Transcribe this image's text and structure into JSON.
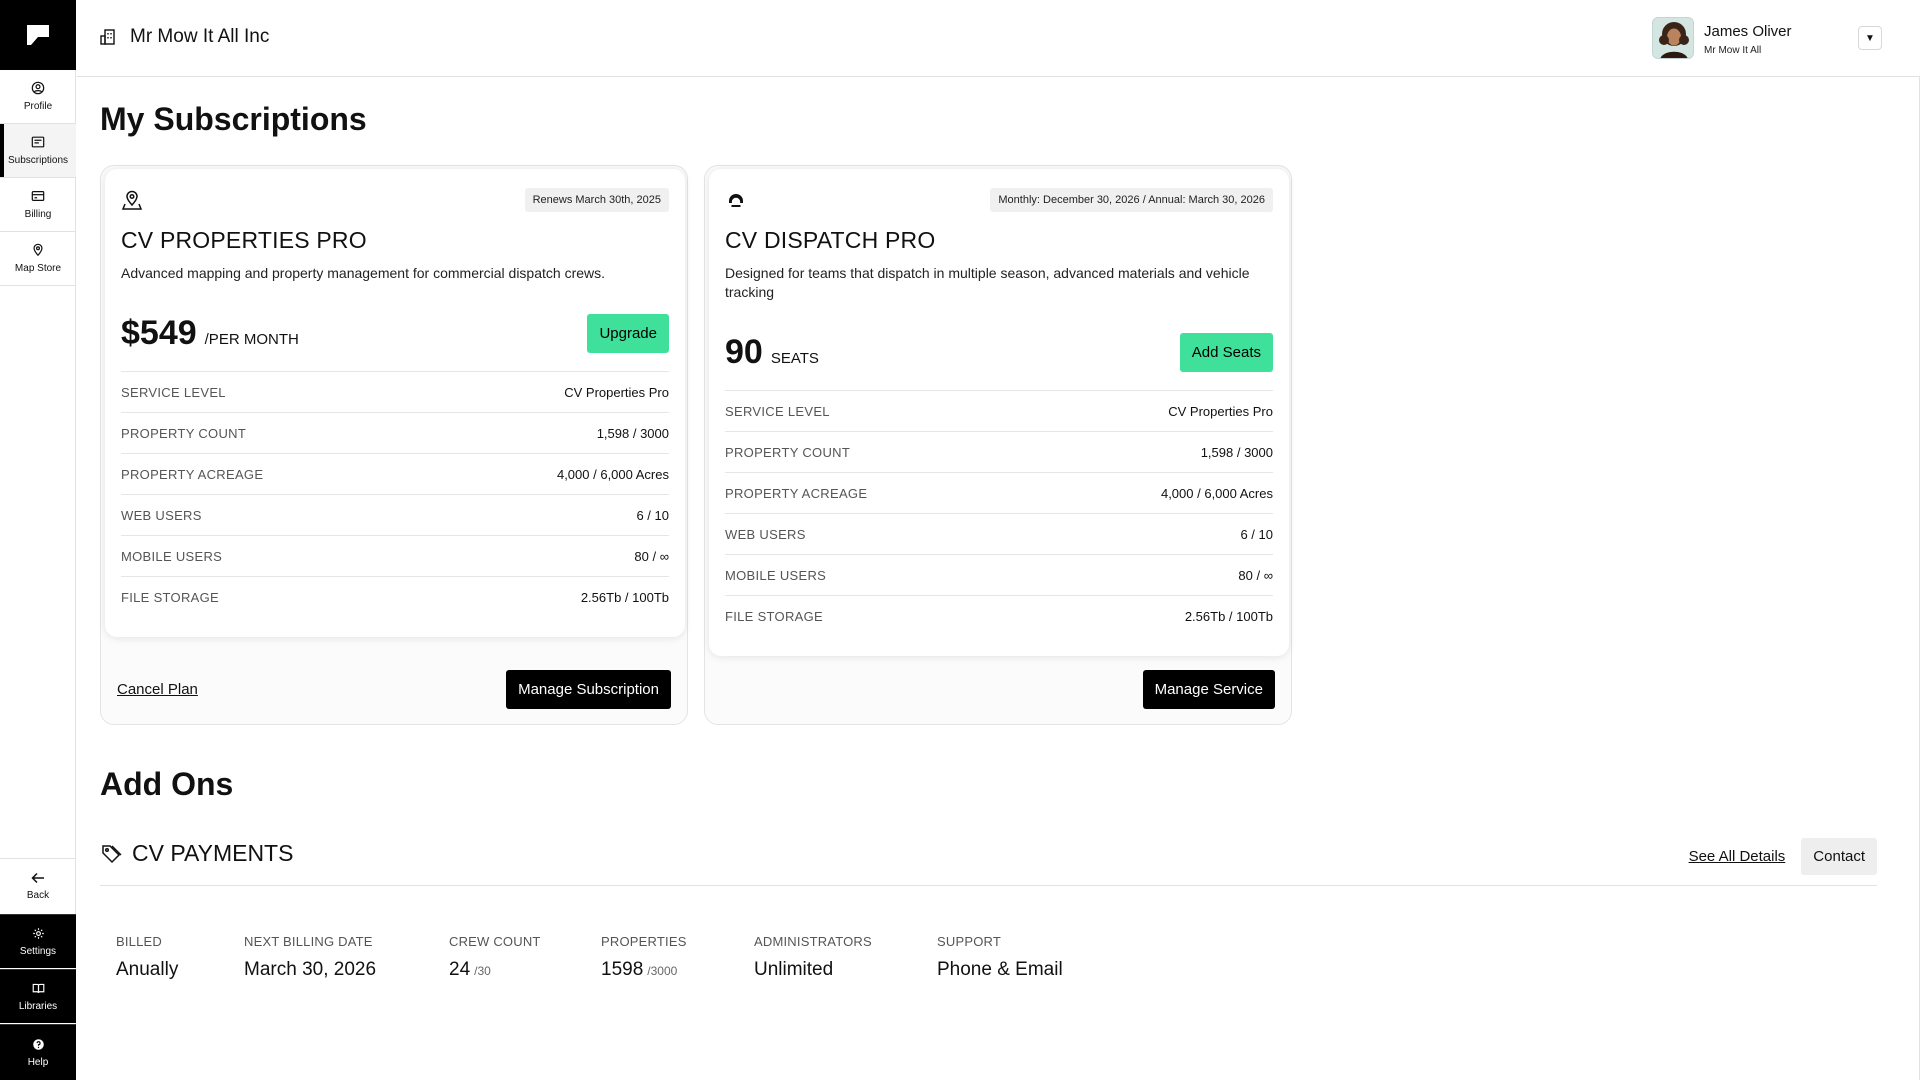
{
  "sidebar": {
    "items": [
      {
        "label": "Profile",
        "icon": "profile-icon"
      },
      {
        "label": "Subscriptions",
        "icon": "subscriptions-icon"
      },
      {
        "label": "Billing",
        "icon": "billing-icon"
      },
      {
        "label": "Map Store",
        "icon": "map-store-icon"
      }
    ],
    "back_label": "Back",
    "bottom_items": [
      {
        "label": "Settings",
        "icon": "settings-icon"
      },
      {
        "label": "Libraries",
        "icon": "libraries-icon"
      },
      {
        "label": "Help",
        "icon": "help-icon"
      }
    ]
  },
  "header": {
    "company_name": "Mr Mow It All Inc",
    "user_name": "James Oliver",
    "user_org": "Mr Mow It All"
  },
  "page_title": "My Subscriptions",
  "subscriptions": [
    {
      "date_badge": "Renews March 30th, 2025",
      "title": "CV PROPERTIES PRO",
      "description": "Advanced mapping and property management for commercial dispatch crews.",
      "price": "$549",
      "price_unit": "/PER MONTH",
      "action_label": "Upgrade",
      "specs": [
        {
          "key": "SERVICE LEVEL",
          "value": "CV Properties Pro"
        },
        {
          "key": "PROPERTY COUNT",
          "value": "1,598 / 3000"
        },
        {
          "key": "PROPERTY ACREAGE",
          "value": "4,000 / 6,000 Acres"
        },
        {
          "key": "WEB USERS",
          "value": "6 / 10"
        },
        {
          "key": "MOBILE USERS",
          "value": "80 / ∞"
        },
        {
          "key": "FILE STORAGE",
          "value": "2.56Tb / 100Tb"
        }
      ],
      "footer_link": "Cancel Plan",
      "footer_button": "Manage Subscription"
    },
    {
      "date_badge": "Monthly: December 30, 2026 / Annual: March 30, 2026",
      "title": "CV DISPATCH PRO",
      "description": "Designed for teams that dispatch in multiple season, advanced materials and vehicle tracking",
      "price": "90",
      "price_unit": "SEATS",
      "action_label": "Add Seats",
      "specs": [
        {
          "key": "SERVICE LEVEL",
          "value": "CV Properties Pro"
        },
        {
          "key": "PROPERTY COUNT",
          "value": "1,598 / 3000"
        },
        {
          "key": "PROPERTY ACREAGE",
          "value": "4,000 / 6,000 Acres"
        },
        {
          "key": "WEB USERS",
          "value": "6 / 10"
        },
        {
          "key": "MOBILE USERS",
          "value": "80 / ∞"
        },
        {
          "key": "FILE STORAGE",
          "value": "2.56Tb / 100Tb"
        }
      ],
      "footer_button": "Manage Service"
    }
  ],
  "addons_title": "Add Ons",
  "addon": {
    "title": "CV PAYMENTS",
    "details_link": "See All Details",
    "contact_label": "Contact",
    "stats": [
      {
        "label": "BILLED",
        "value": "Anually",
        "sub": ""
      },
      {
        "label": "NEXT BILLING DATE",
        "value": "March 30, 2026",
        "sub": ""
      },
      {
        "label": "CREW COUNT",
        "value": "24",
        "sub": "/30"
      },
      {
        "label": "PROPERTIES",
        "value": "1598",
        "sub": "/3000"
      },
      {
        "label": "ADMINISTRATORS",
        "value": "Unlimited",
        "sub": ""
      },
      {
        "label": "SUPPORT",
        "value": "Phone & Email",
        "sub": ""
      }
    ]
  },
  "colors": {
    "accent_green": "#3ee09a",
    "black": "#000000"
  }
}
